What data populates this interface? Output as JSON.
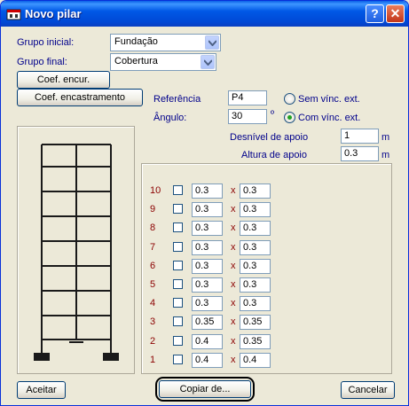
{
  "window": {
    "title": "Novo pilar",
    "help": "?",
    "close": "✕"
  },
  "grupo_inicial": {
    "label": "Grupo inicial:",
    "value": "Fundação"
  },
  "grupo_final": {
    "label": "Grupo final:",
    "value": "Cobertura"
  },
  "buttons": {
    "coef_encur": "Coef. encur.",
    "coef_encastramento": "Coef. encastramento",
    "aceitar": "Aceitar",
    "copiar": "Copiar de...",
    "cancelar": "Cancelar"
  },
  "referencia": {
    "label": "Referência",
    "value": "P4"
  },
  "angulo": {
    "label": "Ângulo:",
    "value": "30",
    "unit": "º"
  },
  "radios": {
    "sem": {
      "label": "Sem vínc. ext.",
      "checked": false
    },
    "com": {
      "label": "Com vínc. ext.",
      "checked": true
    }
  },
  "desnivel": {
    "label": "Desnível de apoio",
    "value": "1",
    "unit": "m"
  },
  "altura": {
    "label": "Altura de apoio",
    "value": "0.3",
    "unit": "m"
  },
  "floors": [
    {
      "num": "10",
      "x": "x",
      "a": "0.3",
      "b": "0.3"
    },
    {
      "num": "9",
      "x": "x",
      "a": "0.3",
      "b": "0.3"
    },
    {
      "num": "8",
      "x": "x",
      "a": "0.3",
      "b": "0.3"
    },
    {
      "num": "7",
      "x": "x",
      "a": "0.3",
      "b": "0.3"
    },
    {
      "num": "6",
      "x": "x",
      "a": "0.3",
      "b": "0.3"
    },
    {
      "num": "5",
      "x": "x",
      "a": "0.3",
      "b": "0.3"
    },
    {
      "num": "4",
      "x": "x",
      "a": "0.3",
      "b": "0.3"
    },
    {
      "num": "3",
      "x": "x",
      "a": "0.35",
      "b": "0.35"
    },
    {
      "num": "2",
      "x": "x",
      "a": "0.4",
      "b": "0.35"
    },
    {
      "num": "1",
      "x": "x",
      "a": "0.4",
      "b": "0.4"
    }
  ]
}
